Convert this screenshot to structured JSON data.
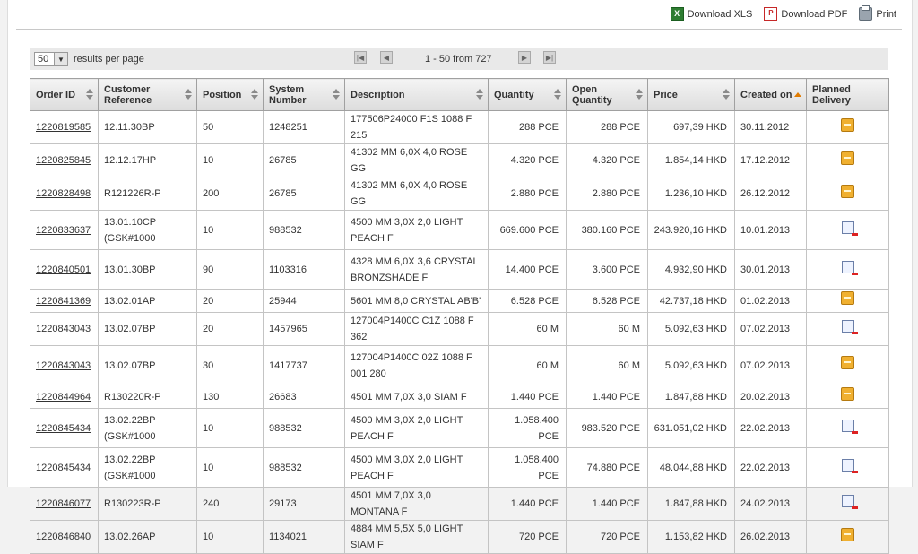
{
  "toolbar": {
    "download_xls": "Download XLS",
    "download_pdf": "Download PDF",
    "print": "Print"
  },
  "pager": {
    "per_page_value": "50",
    "per_page_label": "results per page",
    "range_text": "1 - 50  from 727"
  },
  "columns": [
    "Order ID",
    "Customer Reference",
    "Position",
    "System Number",
    "Description",
    "Quantity",
    "Open Quantity",
    "Price",
    "Created on",
    "Planned Delivery"
  ],
  "rows": [
    {
      "order": "1220819585",
      "ref": "12.11.30BP",
      "pos": "50",
      "sys": "1248251",
      "desc": "177506P24000 F1S 1088 F 215",
      "qty": "288 PCE",
      "open": "288 PCE",
      "price": "697,39 HKD",
      "created": "30.11.2012",
      "delivery": "box"
    },
    {
      "order": "1220825845",
      "ref": "12.12.17HP",
      "pos": "10",
      "sys": "26785",
      "desc": "41302 MM 6,0X 4,0 ROSE GG",
      "qty": "4.320 PCE",
      "open": "4.320 PCE",
      "price": "1.854,14 HKD",
      "created": "17.12.2012",
      "delivery": "box"
    },
    {
      "order": "1220828498",
      "ref": "R121226R-P",
      "pos": "200",
      "sys": "26785",
      "desc": "41302 MM 6,0X 4,0 ROSE GG",
      "qty": "2.880 PCE",
      "open": "2.880 PCE",
      "price": "1.236,10 HKD",
      "created": "26.12.2012",
      "delivery": "box"
    },
    {
      "order": "1220833637",
      "ref": "13.01.10CP (GSK#1000",
      "pos": "10",
      "sys": "988532",
      "desc": "4500 MM 3,0X 2,0 LIGHT PEACH F",
      "qty": "669.600 PCE",
      "open": "380.160 PCE",
      "price": "243.920,16 HKD",
      "created": "10.01.2013",
      "delivery": "ok"
    },
    {
      "order": "1220840501",
      "ref": "13.01.30BP",
      "pos": "90",
      "sys": "1103316",
      "desc": "4328 MM 6,0X 3,6 CRYSTAL BRONZSHADE F",
      "qty": "14.400 PCE",
      "open": "3.600 PCE",
      "price": "4.932,90 HKD",
      "created": "30.01.2013",
      "delivery": "ok"
    },
    {
      "order": "1220841369",
      "ref": "13.02.01AP",
      "pos": "20",
      "sys": "25944",
      "desc": "5601 MM 8,0 CRYSTAL AB'B'",
      "qty": "6.528 PCE",
      "open": "6.528 PCE",
      "price": "42.737,18 HKD",
      "created": "01.02.2013",
      "delivery": "box"
    },
    {
      "order": "1220843043",
      "ref": "13.02.07BP",
      "pos": "20",
      "sys": "1457965",
      "desc": "127004P1400C C1Z 1088 F 362",
      "qty": "60 M",
      "open": "60 M",
      "price": "5.092,63 HKD",
      "created": "07.02.2013",
      "delivery": "ok"
    },
    {
      "order": "1220843043",
      "ref": "13.02.07BP",
      "pos": "30",
      "sys": "1417737",
      "desc": "127004P1400C 02Z 1088 F 001 280",
      "qty": "60 M",
      "open": "60 M",
      "price": "5.092,63 HKD",
      "created": "07.02.2013",
      "delivery": "box"
    },
    {
      "order": "1220844964",
      "ref": "R130220R-P",
      "pos": "130",
      "sys": "26683",
      "desc": "4501 MM 7,0X 3,0 SIAM F",
      "qty": "1.440 PCE",
      "open": "1.440 PCE",
      "price": "1.847,88 HKD",
      "created": "20.02.2013",
      "delivery": "box"
    },
    {
      "order": "1220845434",
      "ref": "13.02.22BP (GSK#1000",
      "pos": "10",
      "sys": "988532",
      "desc": "4500 MM 3,0X 2,0 LIGHT PEACH F",
      "qty": "1.058.400 PCE",
      "open": "983.520 PCE",
      "price": "631.051,02 HKD",
      "created": "22.02.2013",
      "delivery": "ok"
    },
    {
      "order": "1220845434",
      "ref": "13.02.22BP (GSK#1000",
      "pos": "10",
      "sys": "988532",
      "desc": "4500 MM 3,0X 2,0 LIGHT PEACH F",
      "qty": "1.058.400 PCE",
      "open": "74.880 PCE",
      "price": "48.044,88 HKD",
      "created": "22.02.2013",
      "delivery": "ok"
    },
    {
      "order": "1220846077",
      "ref": "R130223R-P",
      "pos": "240",
      "sys": "29173",
      "desc": "4501 MM 7,0X 3,0 MONTANA F",
      "qty": "1.440 PCE",
      "open": "1.440 PCE",
      "price": "1.847,88 HKD",
      "created": "24.02.2013",
      "delivery": "ok"
    },
    {
      "order": "1220846840",
      "ref": "13.02.26AP",
      "pos": "10",
      "sys": "1134021",
      "desc": "4884 MM 5,5X 5,0 LIGHT SIAM F",
      "qty": "720 PCE",
      "open": "720 PCE",
      "price": "1.153,82 HKD",
      "created": "26.02.2013",
      "delivery": "box"
    }
  ]
}
